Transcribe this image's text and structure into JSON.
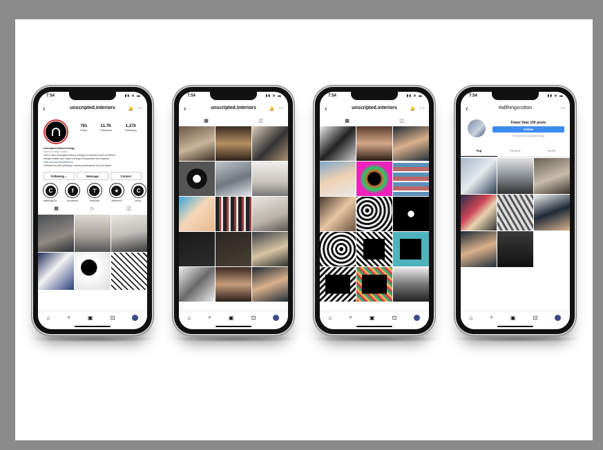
{
  "common": {
    "time": "7:54",
    "status_icons": "▮▮ ≋ ▬",
    "back_glyph": "‹",
    "bell_glyph": "🔔",
    "more_glyph": "···",
    "nav_icons": [
      "⌂",
      "⌕",
      "▣",
      "⊡"
    ]
  },
  "phone1": {
    "username": "unscripted.interiors",
    "stats": [
      {
        "n": "791",
        "l": "Posts"
      },
      {
        "n": "11.7K",
        "l": "Followers"
      },
      {
        "n": "1,376",
        "l": "Following"
      }
    ],
    "bio": {
      "name": "Unscripted Interior Design",
      "category": "Interior Design Studio",
      "line1": "UID is now Unscripted Interior Design! A selected brand of interior",
      "line2": "design enable who value of things Unexpected and Inspired.",
      "link": "linktr.ee/unscriptedinteriors",
      "followed": "Followed by with_jhdesign, outdoor.dimensions and 28 others"
    },
    "buttons": [
      "Following ⌄",
      "Message",
      "Contact"
    ],
    "highlights": [
      {
        "glyph": "C",
        "label": "#allthingsCo.."
      },
      {
        "glyph": "f",
        "label": "#rockstars"
      },
      {
        "glyph": "⊤",
        "label": "#uintcafe"
      },
      {
        "glyph": "★",
        "label": "#featured"
      },
      {
        "glyph": "C",
        "label": "#insp.."
      }
    ],
    "tab_icons": [
      "▦",
      "▷",
      "◫"
    ]
  },
  "phone2": {
    "username": "unscripted.interiors",
    "tab_icons": [
      "▦",
      "◫"
    ]
  },
  "phone3": {
    "username": "unscripted.interiors",
    "tab_icons": [
      "▦",
      "◫"
    ]
  },
  "phone4": {
    "username": "#allthingscolton",
    "count": "Fewer than 100 posts",
    "follow": "Follow",
    "followed_by": "Followed by unscripted.living",
    "tabs": [
      "Top",
      "Recent",
      "Reels"
    ]
  }
}
